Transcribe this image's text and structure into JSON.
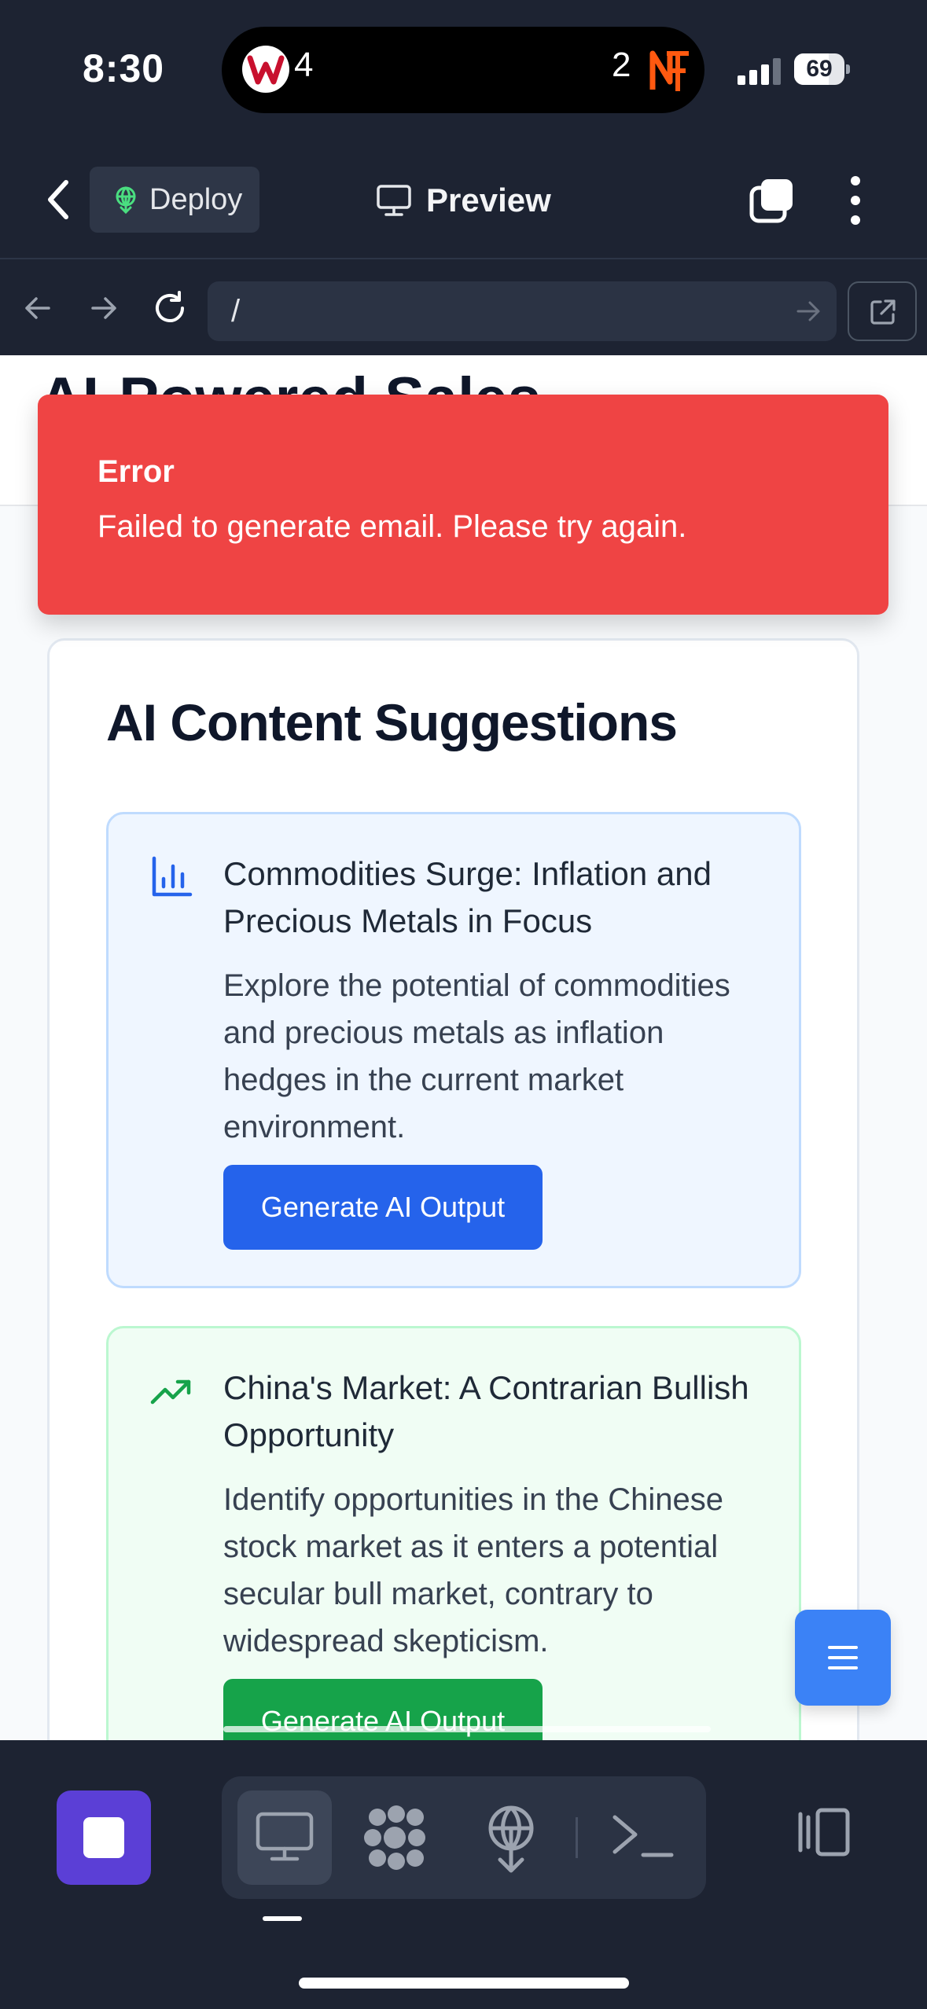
{
  "status_bar": {
    "time": "8:30",
    "live_activity": {
      "left_team": "Nationals",
      "left_score": "4",
      "right_team": "Mets",
      "right_score": "2"
    },
    "signal_icon": "cellular-signal-icon",
    "battery_level": "69",
    "battery_fraction": 0.69
  },
  "app_header": {
    "back_icon": "chevron-left-icon",
    "deploy_label": "Deploy",
    "preview_label": "Preview",
    "tabs_icon": "tabs-icon",
    "more_icon": "vertical-ellipsis-icon"
  },
  "browser_bar": {
    "url": "/",
    "back_icon": "arrow-left-icon",
    "forward_icon": "arrow-right-icon",
    "reload_icon": "reload-icon",
    "open_external_icon": "external-link-icon"
  },
  "page": {
    "title": "AI-Powered Sales"
  },
  "error_toast": {
    "title": "Error",
    "message": "Failed to generate email. Please try again.",
    "color": "#ef4444"
  },
  "suggestions": {
    "title": "AI Content Suggestions",
    "items": [
      {
        "icon": "bar-chart-icon",
        "title": "Commodities Surge: Inflation and Precious Metals in Focus",
        "description": "Explore the potential of commodities and precious metals as inflation hedges in the current market environment.",
        "button_label": "Generate AI Output",
        "accent": "#2563eb"
      },
      {
        "icon": "trending-up-icon",
        "title": "China's Market: A Contrarian Bullish Opportunity",
        "description": "Identify opportunities in the Chinese stock market as it enters a potential secular bull market, contrary to widespread skepticism.",
        "button_label": "Generate AI Output",
        "accent": "#16a34a"
      }
    ]
  },
  "fab": {
    "icon": "hamburger-menu-icon",
    "color": "#3b82f6"
  },
  "bottom_toolbar": {
    "stop_color": "#5b3fd6",
    "tools": [
      "monitor-icon",
      "integrations-icon",
      "deploy-icon",
      "terminal-icon"
    ],
    "active_tool": "monitor-icon",
    "panel_icon": "panel-toggle-icon"
  }
}
